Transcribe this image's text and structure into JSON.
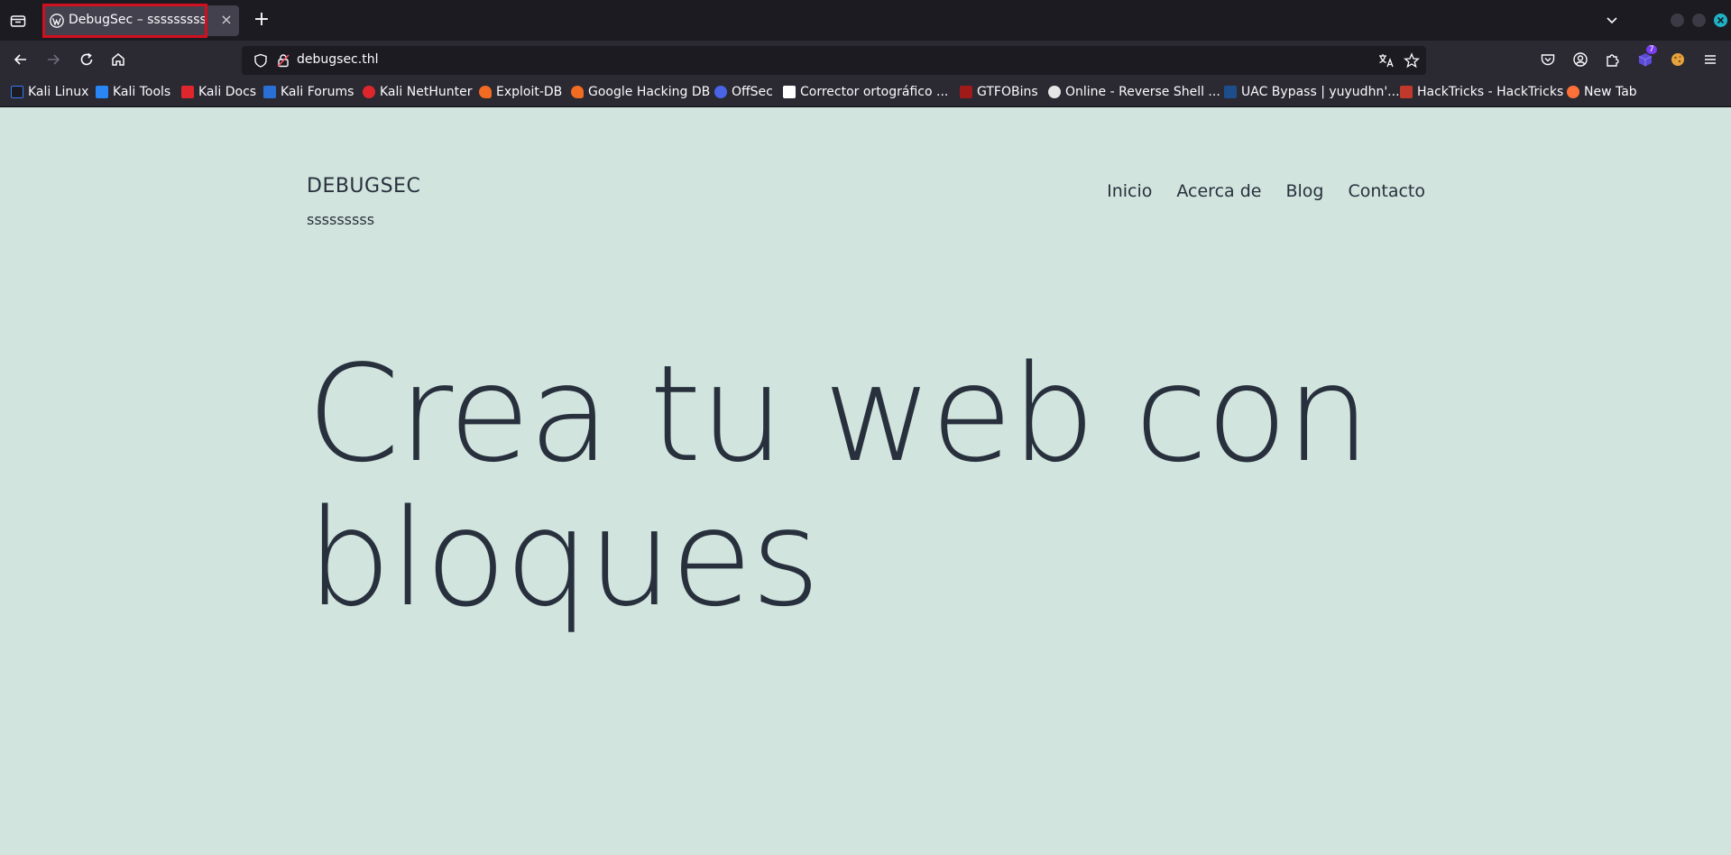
{
  "browser": {
    "tab": {
      "title": "DebugSec – sssssssss",
      "close_glyph": "×"
    },
    "new_tab_glyph": "+",
    "url": "debugsec.thl",
    "extension_badge": "7"
  },
  "bookmarks": [
    {
      "label": "Kali Linux",
      "color": "#367bf0"
    },
    {
      "label": "Kali Tools",
      "color": "#2a86f7"
    },
    {
      "label": "Kali Docs",
      "color": "#e0262d"
    },
    {
      "label": "Kali Forums",
      "color": "#2a6fd6"
    },
    {
      "label": "Kali NetHunter",
      "color": "#e0262d"
    },
    {
      "label": "Exploit-DB",
      "color": "#f26b22"
    },
    {
      "label": "Google Hacking DB",
      "color": "#f26b22"
    },
    {
      "label": "OffSec",
      "color": "#4a64e8"
    },
    {
      "label": "Corrector ortográfico ...",
      "color": "#ffffff"
    },
    {
      "label": "GTFOBins",
      "color": "#a11a1a"
    },
    {
      "label": "Online - Reverse Shell ...",
      "color": "#e6e6e6"
    },
    {
      "label": "UAC Bypass | yuyudhn'...",
      "color": "#1e4d8c"
    },
    {
      "label": "HackTricks - HackTricks",
      "color": "#c0392b"
    },
    {
      "label": "New Tab",
      "color": "#ff7139"
    }
  ],
  "site": {
    "title": "DEBUGSEC",
    "description": "sssssssss",
    "nav": [
      "Inicio",
      "Acerca de",
      "Blog",
      "Contacto"
    ],
    "hero_line1": "Crea tu web con",
    "hero_line2": "bloques"
  }
}
